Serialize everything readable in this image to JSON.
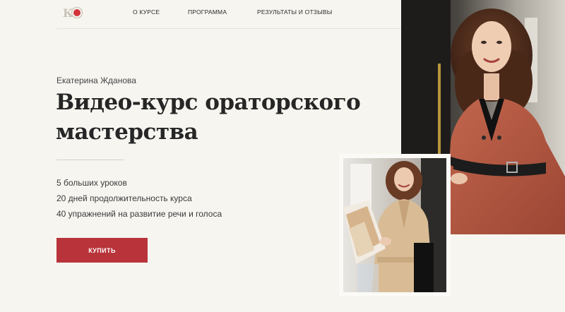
{
  "header": {
    "logo_text": "КЖ",
    "nav": [
      {
        "label": "О курсе"
      },
      {
        "label": "Программа"
      },
      {
        "label": "Результаты и отзывы"
      }
    ]
  },
  "hero": {
    "author": "Екатерина Жданова",
    "title_line1": "Видео-курс ораторского",
    "title_line2": "мастерства",
    "features": [
      "5 больших уроков",
      "20 дней продолжительность курса",
      "40 упражнений на развитие речи и голоса"
    ],
    "buy_label": "Купить"
  },
  "colors": {
    "background": "#f7f5f0",
    "accent": "#b8343a",
    "text": "#262626"
  }
}
